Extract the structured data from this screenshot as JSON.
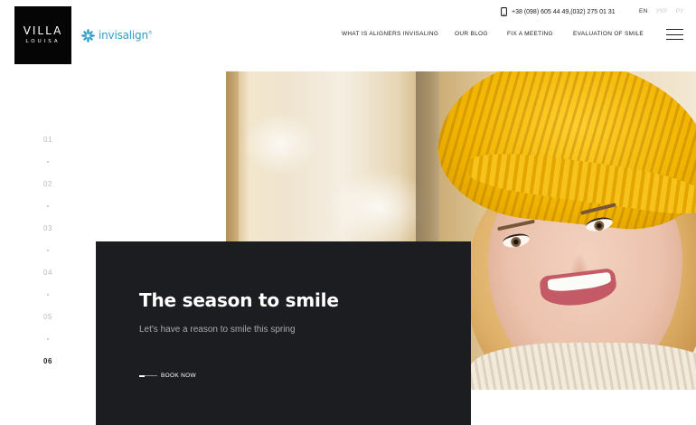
{
  "logo": {
    "line1": "VILLA",
    "line2": "LOUISA"
  },
  "partner": {
    "name": "invisalign",
    "mark": "®",
    "icon": "asterisk-flower-icon",
    "color": "#2f9ec9"
  },
  "contact": {
    "phone_icon": "mobile-phone-icon",
    "phones": "+38 (098) 605 44 49,(032) 275 01 31"
  },
  "languages": [
    {
      "code": "EN",
      "active": true
    },
    {
      "code": "УКР",
      "active": false
    },
    {
      "code": "РУ",
      "active": false
    }
  ],
  "nav": {
    "items": [
      {
        "label": "WHAT IS ALIGNERS INVISALING"
      },
      {
        "label": "OUR BLOG"
      },
      {
        "label": "FIX A MEETING"
      },
      {
        "label": "EVALUATION OF SMILE"
      }
    ],
    "menu_icon": "hamburger-icon"
  },
  "slider": {
    "pages": [
      "01",
      "02",
      "03",
      "04",
      "05",
      "06"
    ],
    "active_index": 5
  },
  "hero": {
    "title": "The season to smile",
    "subtitle": "Let's have a reason to smile this spring",
    "cta_label": "BOOK NOW",
    "image": "smiling-woman-yellow-knit-hat"
  },
  "colors": {
    "panel": "#1c1d21",
    "logo_bg": "#050505",
    "accent": "#2f9ec9"
  }
}
